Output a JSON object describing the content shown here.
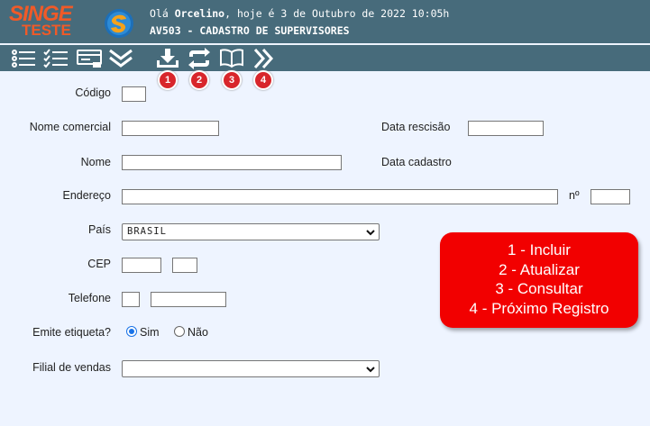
{
  "header": {
    "logo_top": "SINGE",
    "logo_bottom": "TESTE",
    "greeting_prefix": "Olá ",
    "user_name": "Orcelino",
    "greeting_suffix": ", hoje é 3 de Outubro de 2022 10:05h",
    "screen_title": "AV503 - CADASTRO DE SUPERVISORES"
  },
  "toolbar": {
    "left_icons": [
      "list-icon",
      "checklist-icon",
      "card-icon",
      "double-chevron-down-icon"
    ],
    "action_icons": [
      "download-tray-icon",
      "refresh-arrows-icon",
      "open-book-icon",
      "double-chevron-right-icon"
    ],
    "badges": [
      "1",
      "2",
      "3",
      "4"
    ]
  },
  "form": {
    "codigo_label": "Código",
    "codigo_value": "",
    "nome_comercial_label": "Nome comercial",
    "nome_comercial_value": "",
    "data_rescisao_label": "Data rescisão",
    "data_rescisao_value": "",
    "nome_label": "Nome",
    "nome_value": "",
    "data_cadastro_label": "Data cadastro",
    "endereco_label": "Endereço",
    "endereco_value": "",
    "numero_label": "nº",
    "numero_value": "",
    "pais_label": "País",
    "pais_value": "BRASIL",
    "cep_label": "CEP",
    "cep_value_1": "",
    "cep_value_2": "",
    "telefone_label": "Telefone",
    "telefone_ddd": "",
    "telefone_numero": "",
    "emite_etiqueta_label": "Emite etiqueta?",
    "emite_etiqueta_options": [
      "Sim",
      "Não"
    ],
    "emite_etiqueta_selected": "Sim",
    "filial_label": "Filial de vendas",
    "filial_value": ""
  },
  "callout": {
    "lines": [
      "1 - Incluir",
      "2 - Atualizar",
      "3 - Consultar",
      "4 - Próximo Registro"
    ]
  },
  "colors": {
    "header_bg": "#476b7b",
    "page_bg": "#eef4ff",
    "logo_orange": "#f05a28",
    "badge_red": "#d8262b",
    "callout_red": "#f20000",
    "radio_blue": "#1a73e8"
  }
}
